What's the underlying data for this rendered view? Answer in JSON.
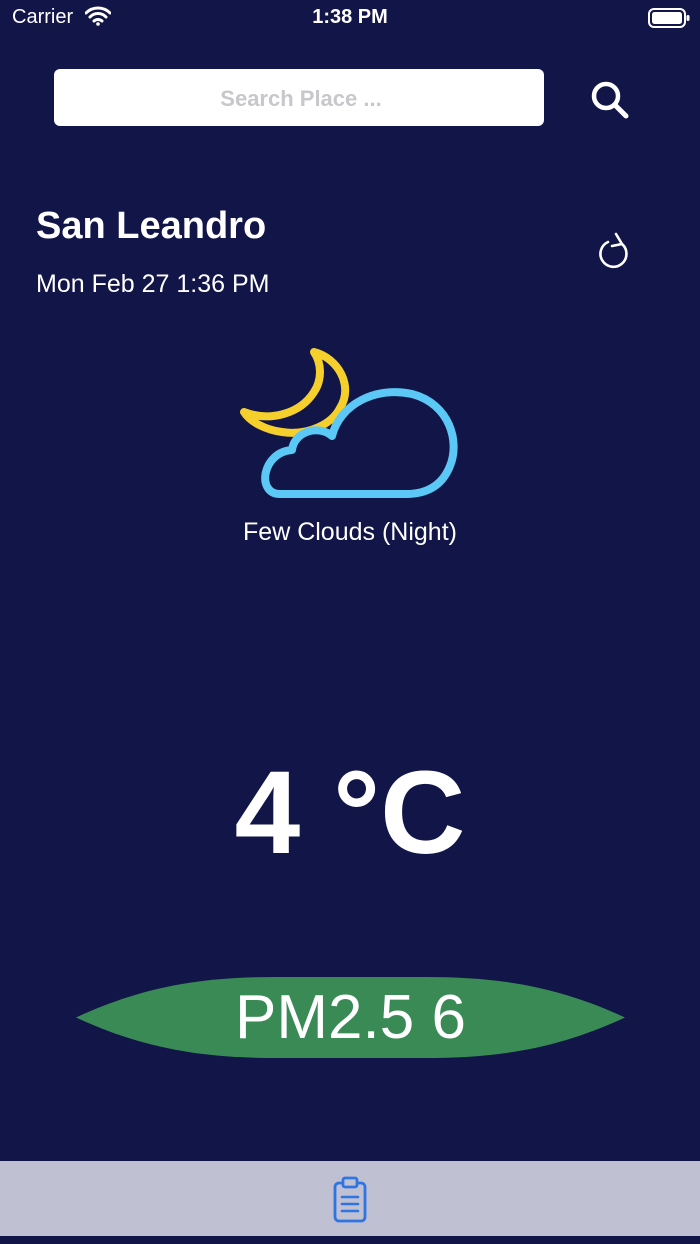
{
  "status_bar": {
    "carrier": "Carrier",
    "time": "1:38 PM"
  },
  "search": {
    "placeholder": "Search Place ...",
    "value": ""
  },
  "location": {
    "city": "San Leandro",
    "datetime": "Mon Feb 27 1:36 PM"
  },
  "weather": {
    "condition": "Few Clouds (Night)",
    "icon": "moon-cloud-icon",
    "temperature": "4 °C"
  },
  "air_quality": {
    "label": "PM2.5 6",
    "color": "#3a8a55"
  },
  "tab_bar": {
    "icon": "clipboard-list-icon"
  },
  "colors": {
    "background": "#121548",
    "moon": "#f5cf2c",
    "cloud": "#5cc8f5",
    "tab_accent": "#2f74e3",
    "tab_background": "#bfc0d1"
  }
}
